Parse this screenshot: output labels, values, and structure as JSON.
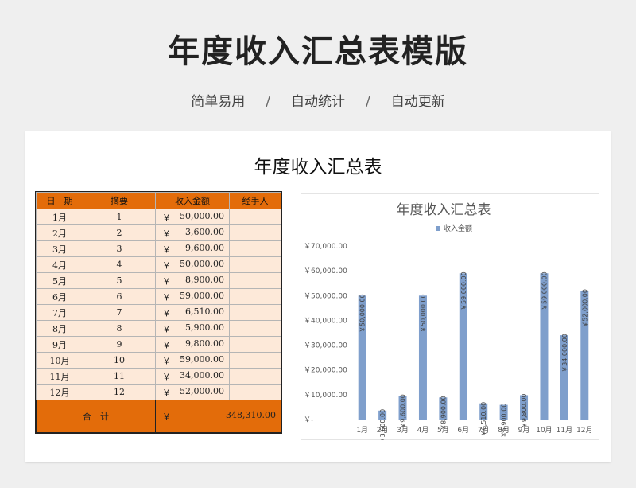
{
  "page": {
    "title": "年度收入汇总表模版",
    "tags": [
      "简单易用",
      "自动统计",
      "自动更新"
    ],
    "separator": "/"
  },
  "sheet": {
    "title": "年度收入汇总表",
    "headers": {
      "date": "日　期",
      "summary": "摘要",
      "amount": "收入金额",
      "handler": "经手人"
    },
    "currency": "￥",
    "rows": [
      {
        "date": "1月",
        "summary": "1",
        "amount": "50,000.00"
      },
      {
        "date": "2月",
        "summary": "2",
        "amount": "3,600.00"
      },
      {
        "date": "3月",
        "summary": "3",
        "amount": "9,600.00"
      },
      {
        "date": "4月",
        "summary": "4",
        "amount": "50,000.00"
      },
      {
        "date": "5月",
        "summary": "5",
        "amount": "8,900.00"
      },
      {
        "date": "6月",
        "summary": "6",
        "amount": "59,000.00"
      },
      {
        "date": "7月",
        "summary": "7",
        "amount": "6,510.00"
      },
      {
        "date": "8月",
        "summary": "8",
        "amount": "5,900.00"
      },
      {
        "date": "9月",
        "summary": "9",
        "amount": "9,800.00"
      },
      {
        "date": "10月",
        "summary": "10",
        "amount": "59,000.00"
      },
      {
        "date": "11月",
        "summary": "11",
        "amount": "34,000.00"
      },
      {
        "date": "12月",
        "summary": "12",
        "amount": "52,000.00"
      }
    ],
    "total_label": "合　计",
    "total_amount": "348,310.00"
  },
  "chart_data": {
    "type": "bar",
    "title": "年度收入汇总表",
    "categories": [
      "1月",
      "2月",
      "3月",
      "4月",
      "5月",
      "6月",
      "7月",
      "8月",
      "9月",
      "10月",
      "11月",
      "12月"
    ],
    "series": [
      {
        "name": "收入金额",
        "values": [
          50000,
          3600,
          9600,
          50000,
          8900,
          59000,
          6510,
          5900,
          9800,
          59000,
          34000,
          52000
        ]
      }
    ],
    "data_labels": [
      "￥50,000.00",
      "￥3,600.00",
      "￥9,600.00",
      "￥50,000.00",
      "￥8,900.00",
      "￥59,000.00",
      "￥6,510.00",
      "￥5,900.00",
      "￥9,800.00",
      "￥59,000.00",
      "￥34,000.00",
      "￥52,000.00"
    ],
    "ylim": [
      0,
      70000
    ],
    "y_ticks": [
      "￥-",
      "￥10,000.00",
      "￥20,000.00",
      "￥30,000.00",
      "￥40,000.00",
      "￥50,000.00",
      "￥60,000.00",
      "￥70,000.00"
    ],
    "legend_position": "top",
    "grid": false,
    "bar_color": "#7f9fcc"
  }
}
